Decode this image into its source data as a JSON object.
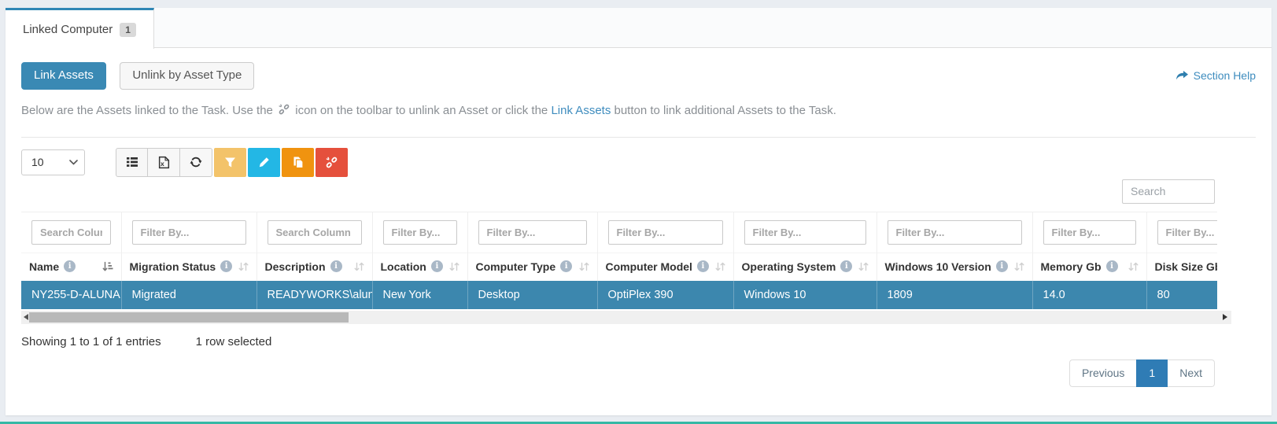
{
  "colors": {
    "tab_accent": "#2e86b5",
    "primary_button": "#3a89b4",
    "link": "#3e8cbe",
    "selected_row": "#3c87ae",
    "filter_button": "#f3c36a",
    "edit_button": "#23b7e5",
    "copy_button": "#f0930f",
    "unlink_button": "#e5503c",
    "pagination_active": "#2f7cb5",
    "bottom_accent": "#35b8a5"
  },
  "tab": {
    "label": "Linked Computer",
    "badge": "1"
  },
  "actions": {
    "link_assets_label": "Link Assets",
    "unlink_by_type_label": "Unlink by Asset Type",
    "section_help_label": "Section Help"
  },
  "description": {
    "part1": "Below are the Assets linked to the Task. Use the",
    "part2": "icon on the toolbar to unlink an Asset or click the",
    "link_text": "Link Assets",
    "part3": "button to link additional Assets to the Task."
  },
  "toolbar": {
    "page_size": "10",
    "page_size_options": [
      "10"
    ],
    "search_placeholder": "Search",
    "icons": [
      "list-icon",
      "excel-file-icon",
      "refresh-icon",
      "filter-funnel-icon",
      "pencil-icon",
      "copy-icon",
      "unlink-icon"
    ]
  },
  "table": {
    "columns": [
      {
        "label": "Name",
        "filter_placeholder": "Search Column",
        "sorted": true
      },
      {
        "label": "Migration Status",
        "filter_placeholder": "Filter By..."
      },
      {
        "label": "Description",
        "filter_placeholder": "Search Column"
      },
      {
        "label": "Location",
        "filter_placeholder": "Filter By..."
      },
      {
        "label": "Computer Type",
        "filter_placeholder": "Filter By..."
      },
      {
        "label": "Computer Model",
        "filter_placeholder": "Filter By..."
      },
      {
        "label": "Operating System",
        "filter_placeholder": "Filter By..."
      },
      {
        "label": "Windows 10 Version",
        "filter_placeholder": "Filter By..."
      },
      {
        "label": "Memory Gb",
        "filter_placeholder": "Filter By..."
      },
      {
        "label": "Disk Size Gb",
        "filter_placeholder": "Filter By..."
      }
    ],
    "rows": [
      {
        "selected": true,
        "cells": [
          "NY255-D-ALUNA",
          "Migrated",
          "READYWORKS\\aluna",
          "New York",
          "Desktop",
          "OptiPlex 390",
          "Windows 10",
          "1809",
          "14.0",
          "80"
        ]
      }
    ]
  },
  "footer": {
    "showing_text": "Showing 1 to 1 of 1 entries",
    "selected_text": "1 row selected"
  },
  "pagination": {
    "previous_label": "Previous",
    "current_page": "1",
    "next_label": "Next"
  }
}
